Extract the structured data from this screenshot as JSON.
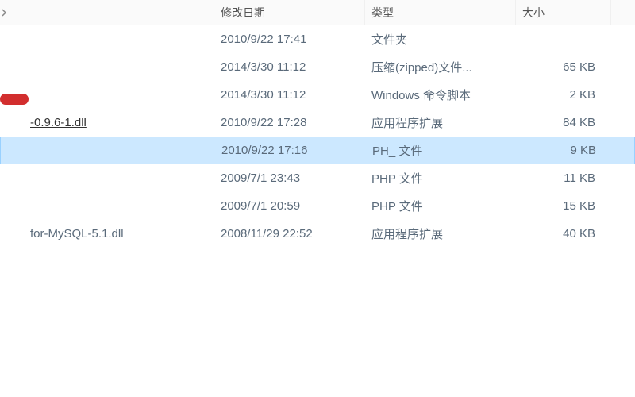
{
  "columns": {
    "date": "修改日期",
    "type": "类型",
    "size": "大小"
  },
  "rows": [
    {
      "name": "",
      "date": "2010/9/22 17:41",
      "type": "文件夹",
      "size": "",
      "underlined": false,
      "selected": false
    },
    {
      "name": "",
      "date": "2014/3/30 11:12",
      "type": "压缩(zipped)文件...",
      "size": "65 KB",
      "underlined": false,
      "selected": false
    },
    {
      "name": "",
      "date": "2014/3/30 11:12",
      "type": "Windows 命令脚本",
      "size": "2 KB",
      "underlined": false,
      "selected": false
    },
    {
      "name": "-0.9.6-1.dll",
      "date": "2010/9/22 17:28",
      "type": "应用程序扩展",
      "size": "84 KB",
      "underlined": true,
      "selected": false
    },
    {
      "name": "",
      "date": "2010/9/22 17:16",
      "type": "PH_ 文件",
      "size": "9 KB",
      "underlined": false,
      "selected": true
    },
    {
      "name": "",
      "date": "2009/7/1 23:43",
      "type": "PHP 文件",
      "size": "11 KB",
      "underlined": false,
      "selected": false
    },
    {
      "name": "",
      "date": "2009/7/1 20:59",
      "type": "PHP 文件",
      "size": "15 KB",
      "underlined": false,
      "selected": false
    },
    {
      "name": "for-MySQL-5.1.dll",
      "date": "2008/11/29 22:52",
      "type": "应用程序扩展",
      "size": "40 KB",
      "underlined": false,
      "selected": false
    }
  ]
}
